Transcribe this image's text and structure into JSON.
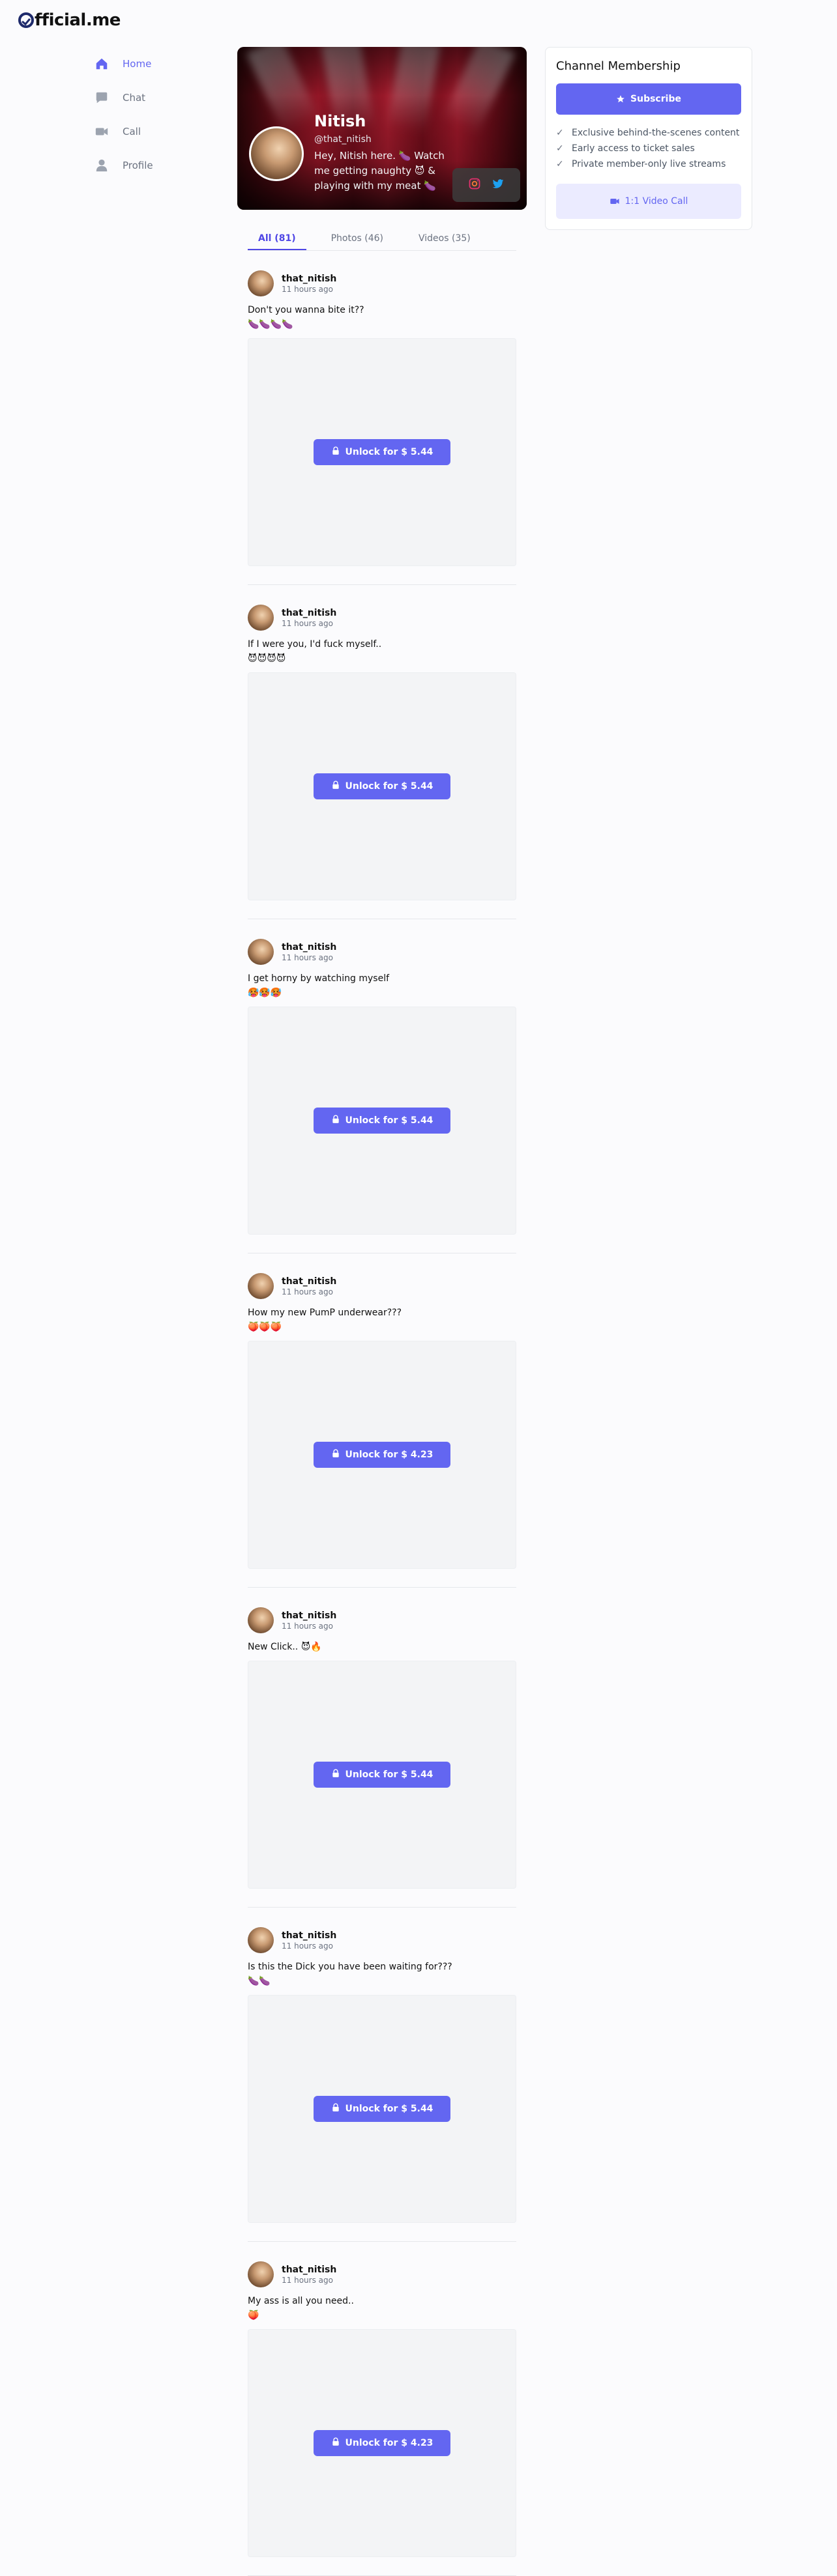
{
  "brand": {
    "name": "fficial.me"
  },
  "nav": [
    {
      "label": "Home",
      "icon": "home-icon",
      "active": true
    },
    {
      "label": "Chat",
      "icon": "chat-icon",
      "active": false
    },
    {
      "label": "Call",
      "icon": "video-icon",
      "active": false
    },
    {
      "label": "Profile",
      "icon": "user-icon",
      "active": false
    }
  ],
  "profile": {
    "name": "Nitish",
    "handle": "@that_nitish",
    "bio": "Hey, Nitish here. 🍆 Watch me getting naughty 😈 & playing with my meat 🍆",
    "socials": [
      "instagram-icon",
      "twitter-icon"
    ]
  },
  "tabs": [
    {
      "label": "All (81)",
      "active": true
    },
    {
      "label": "Photos (46)",
      "active": false
    },
    {
      "label": "Videos (35)",
      "active": false
    }
  ],
  "posts": [
    {
      "user": "that_nitish",
      "time": "11 hours ago",
      "text": "Don't you wanna bite it??\n🍆🍆🍆🍆",
      "unlock": "Unlock for $ 5.44"
    },
    {
      "user": "that_nitish",
      "time": "11 hours ago",
      "text": "If I were you, I'd fuck myself..\n😈😈😈😈",
      "unlock": "Unlock for $ 5.44"
    },
    {
      "user": "that_nitish",
      "time": "11 hours ago",
      "text": "I get horny by watching myself\n🥵🥵🥵",
      "unlock": "Unlock for $ 5.44"
    },
    {
      "user": "that_nitish",
      "time": "11 hours ago",
      "text": "How my new PumP underwear???\n🍑🍑🍑",
      "unlock": "Unlock for $ 4.23"
    },
    {
      "user": "that_nitish",
      "time": "11 hours ago",
      "text": "New Click.. 😈🔥",
      "unlock": "Unlock for $ 5.44"
    },
    {
      "user": "that_nitish",
      "time": "11 hours ago",
      "text": "Is this the Dick you have been waiting for???\n🍆🍆",
      "unlock": "Unlock for $ 5.44"
    },
    {
      "user": "that_nitish",
      "time": "11 hours ago",
      "text": "My ass is all you need..\n🍑",
      "unlock": "Unlock for $ 4.23"
    }
  ],
  "membership": {
    "title": "Channel Membership",
    "subscribe": "Subscribe",
    "perks": [
      "Exclusive behind-the-scenes content",
      "Early access to ticket sales",
      "Private member-only live streams"
    ],
    "call": "1:1 Video Call"
  },
  "colors": {
    "accent": "#6366f1",
    "banner": "#a3182a"
  }
}
